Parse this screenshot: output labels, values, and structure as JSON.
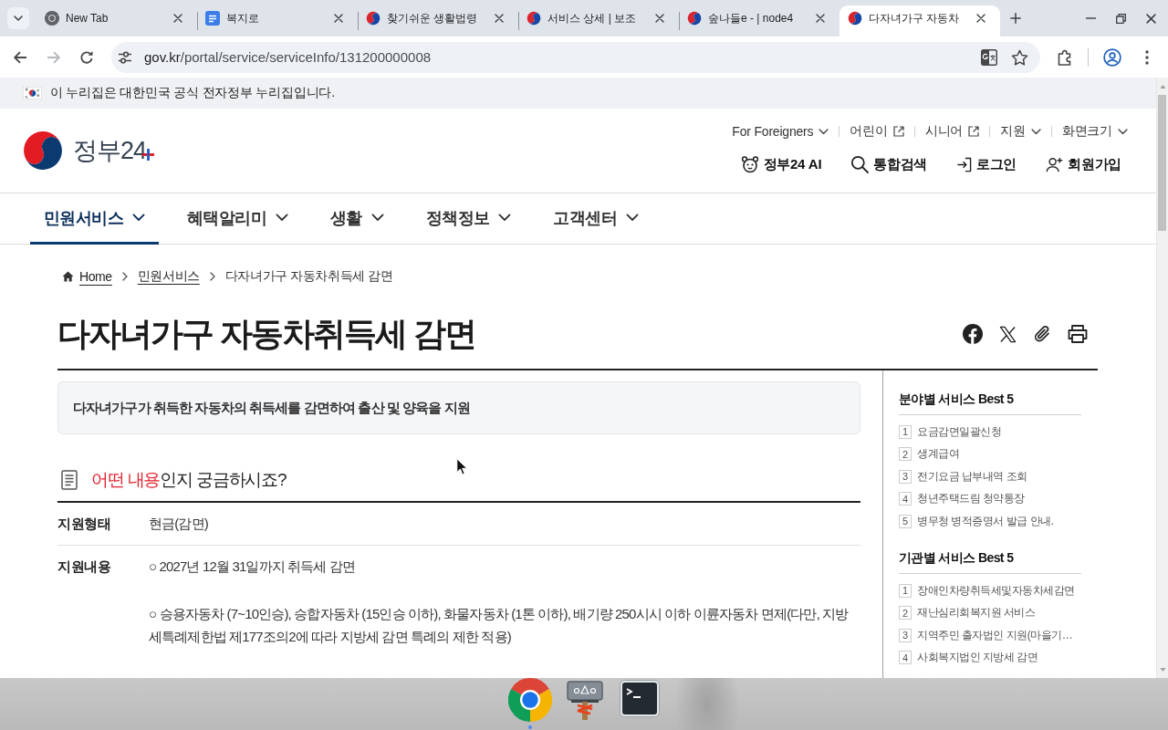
{
  "browser": {
    "tabs": [
      {
        "title": "New Tab",
        "kind": "newtab",
        "selected": false
      },
      {
        "title": "복지로",
        "kind": "portal",
        "selected": false
      },
      {
        "title": "찾기쉬운 생활법령",
        "kind": "gov",
        "selected": false
      },
      {
        "title": "서비스 상세 | 보조",
        "kind": "gov",
        "selected": false
      },
      {
        "title": "숲나들e - | node4",
        "kind": "gov",
        "selected": false
      },
      {
        "title": "다자녀가구 자동차",
        "kind": "gov",
        "selected": true
      }
    ],
    "address": {
      "host": "gov.kr",
      "path": "/portal/service/serviceInfo/131200000008"
    }
  },
  "banner": {
    "text": "이 누리집은 대한민국 공식 전자정부 누리집입니다."
  },
  "header": {
    "logo": "정부24",
    "utility_links": [
      {
        "label": "For Foreigners",
        "kind": "menu"
      },
      {
        "label": "어린이",
        "kind": "external"
      },
      {
        "label": "시니어",
        "kind": "external"
      },
      {
        "label": "지원",
        "kind": "menu"
      },
      {
        "label": "화면크기",
        "kind": "menu"
      }
    ],
    "actions": [
      {
        "label": "정부24 AI",
        "kind": "ai"
      },
      {
        "label": "통합검색",
        "kind": "search"
      },
      {
        "label": "로그인",
        "kind": "login"
      },
      {
        "label": "회원가입",
        "kind": "signup"
      }
    ]
  },
  "nav": [
    {
      "label": "민원서비스",
      "selected": true
    },
    {
      "label": "혜택알리미",
      "selected": false
    },
    {
      "label": "생활",
      "selected": false
    },
    {
      "label": "정책정보",
      "selected": false
    },
    {
      "label": "고객센터",
      "selected": false
    }
  ],
  "breadcrumb": [
    {
      "label": "Home",
      "kind": "home"
    },
    {
      "label": "민원서비스",
      "kind": "link"
    },
    {
      "label": "다자녀가구 자동차취득세 감면",
      "kind": "current"
    }
  ],
  "page_title": "다자녀가구 자동차취득세 감면",
  "summary": "다자녀가구가 취득한 자동차의 취득세를 감면하여 출산 및 양육을 지원",
  "section": {
    "heading_highlight": "어떤 내용",
    "heading_rest": "인지 궁금하시죠?",
    "rows": [
      {
        "label": "지원형태",
        "paragraphs": [
          "현금(감면)"
        ]
      },
      {
        "label": "지원내용",
        "paragraphs": [
          "○ 2027년 12월 31일까지 취득세 감면",
          "○ 승용자동차 (7~10인승), 승합자동차 (15인승 이하), 화물자동차 (1톤 이하), 배기량 250시시 이하 이륜자동차 면제(다만, 지방세특례제한법 제177조의2에 따라 지방세 감면 특례의 제한 적용)"
        ]
      }
    ]
  },
  "sidebar": [
    {
      "title": "분야별 서비스 Best 5",
      "items": [
        {
          "rank": "1",
          "label": "요금감면일괄신청"
        },
        {
          "rank": "2",
          "label": "생계급여"
        },
        {
          "rank": "3",
          "label": "전기요금 납부내역 조회"
        },
        {
          "rank": "4",
          "label": "청년주택드림 청약통장"
        },
        {
          "rank": "5",
          "label": "병무청 병적증명서 발급 안내."
        }
      ]
    },
    {
      "title": "기관별 서비스 Best 5",
      "items": [
        {
          "rank": "1",
          "label": "장애인차량취득세및자동차세감면"
        },
        {
          "rank": "2",
          "label": "재난심리회복지원 서비스"
        },
        {
          "rank": "3",
          "label": "지역주민 출자법인 지원(마을기…"
        },
        {
          "rank": "4",
          "label": "사회복지법인 지방세 감면"
        }
      ]
    }
  ]
}
